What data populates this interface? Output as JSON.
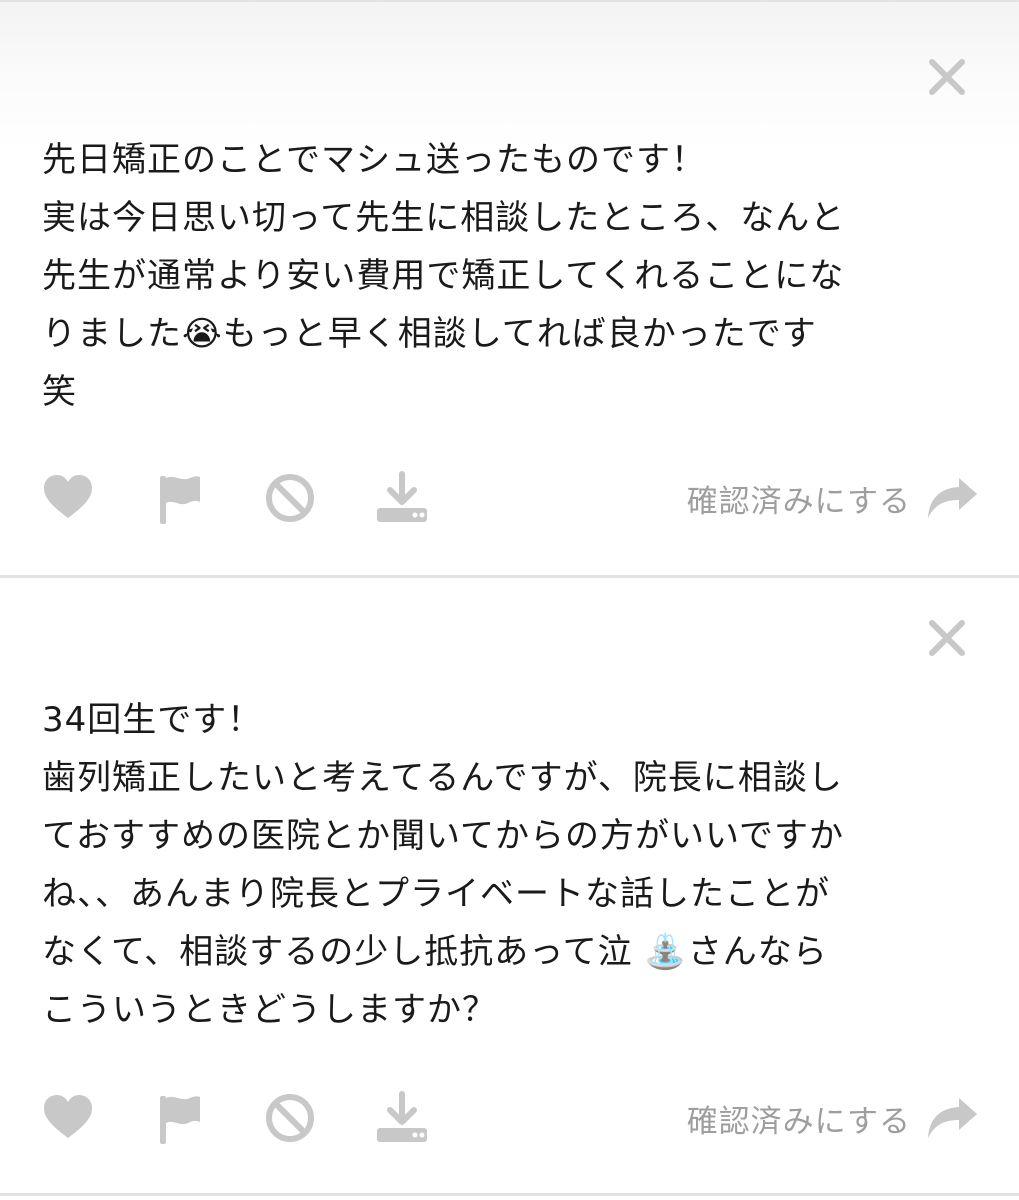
{
  "colors": {
    "icon_gray": "#c8c8c8",
    "text": "#1a1a1a",
    "confirm_text": "#9e9e9e",
    "divider": "#e2e2e2"
  },
  "messages": [
    {
      "lines": [
        "先日矯正のことでマシュ送ったものです！",
        "実は今日思い切って先生に相談したところ、なんと",
        "先生が通常より安い費用で矯正してくれることにな",
        "りました😭もっと早く相談してれば良かったです",
        "笑"
      ],
      "icons": [
        "heart-icon",
        "flag-icon",
        "block-icon",
        "download-icon",
        "close-icon",
        "share-arrow-icon"
      ],
      "confirm_label": "確認済みにする"
    },
    {
      "lines": [
        "34回生です！",
        "歯列矯正したいと考えてるんですが、院長に相談し",
        "ておすすめの医院とか聞いてからの方がいいですか",
        "ね、、あんまり院長とプライベートな話したことが",
        "なくて、相談するの少し抵抗あって泣 ⛲さんなら",
        "こういうときどうしますか？"
      ],
      "icons": [
        "heart-icon",
        "flag-icon",
        "block-icon",
        "download-icon",
        "close-icon",
        "share-arrow-icon"
      ],
      "confirm_label": "確認済みにする"
    }
  ]
}
